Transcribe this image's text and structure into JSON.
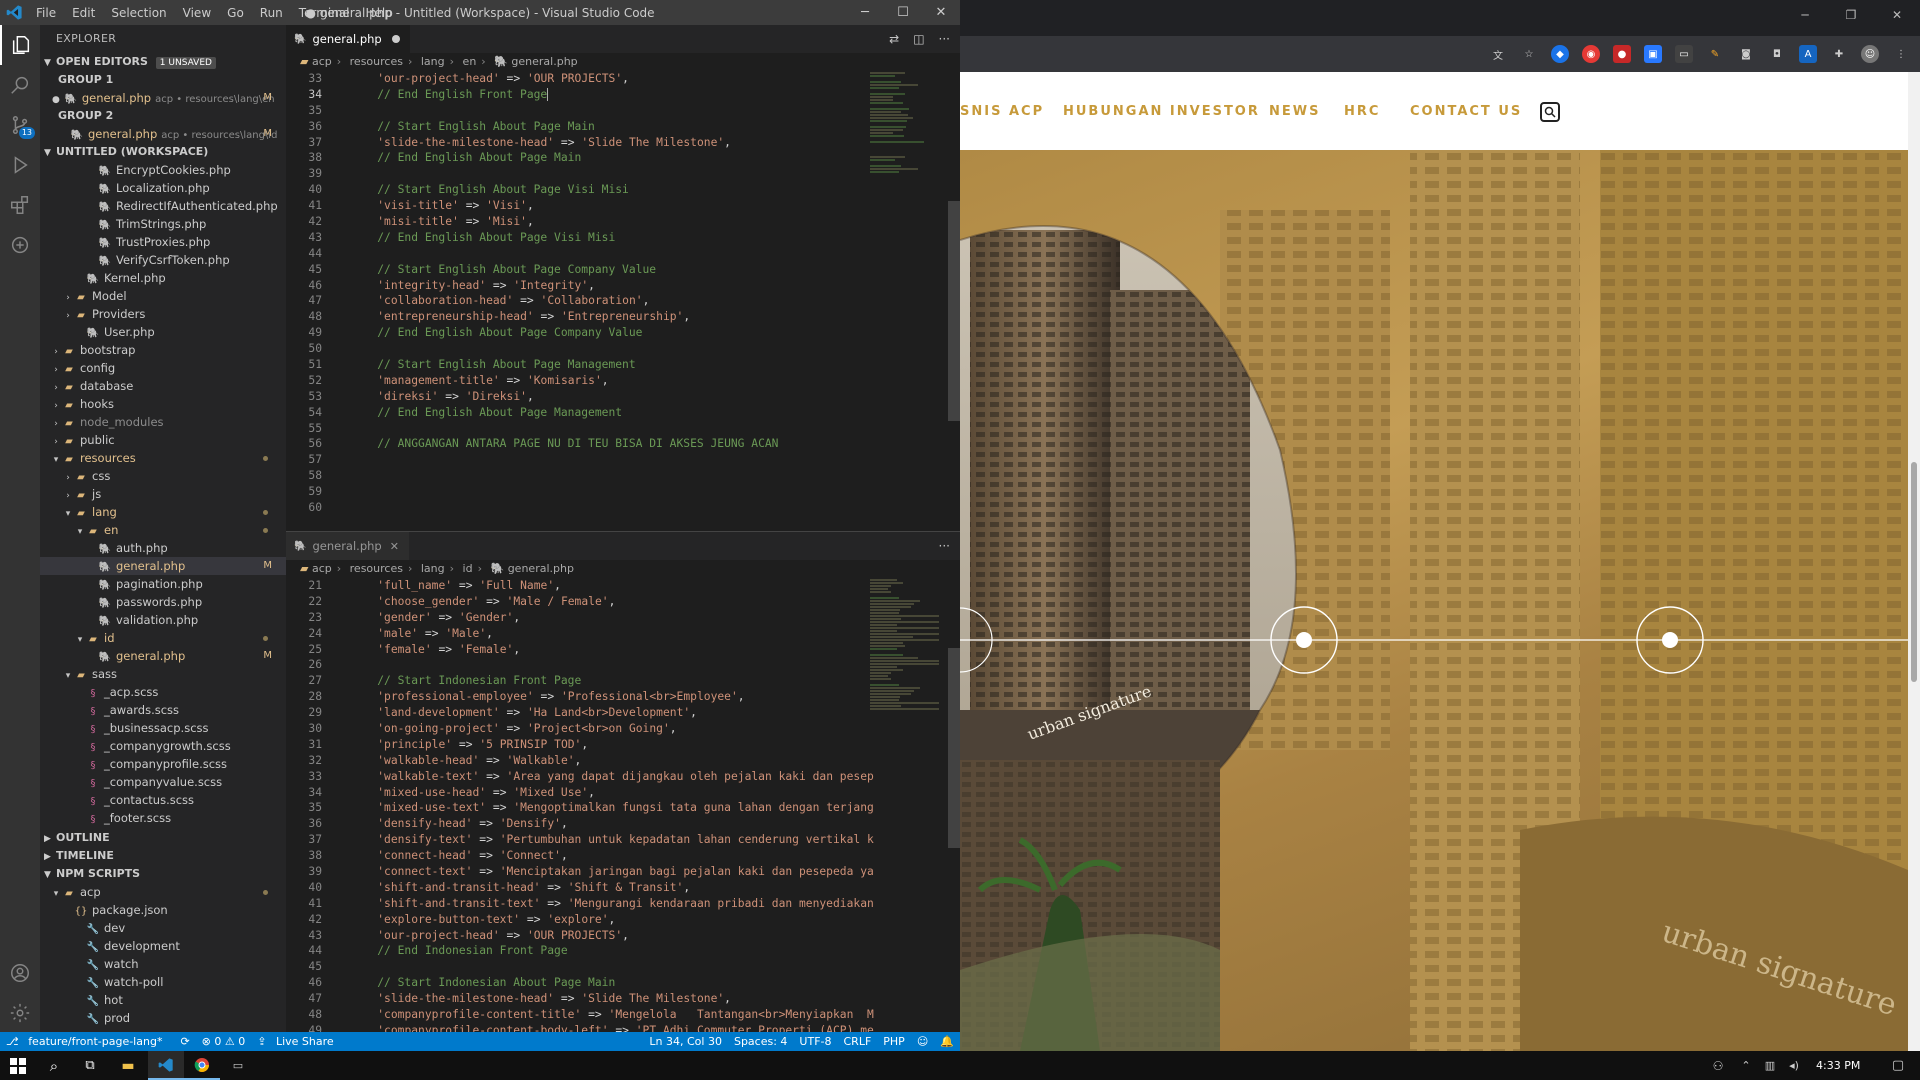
{
  "window": {
    "title": "● general.php - Untitled (Workspace) - Visual Studio Code",
    "menu": [
      "File",
      "Edit",
      "Selection",
      "View",
      "Go",
      "Run",
      "Terminal",
      "Help"
    ]
  },
  "activity_bar": {
    "scm_badge": "13"
  },
  "sidebar": {
    "title": "EXPLORER",
    "open_editors": {
      "label": "OPEN EDITORS",
      "badge": "1 UNSAVED"
    },
    "group1": {
      "label": "GROUP 1",
      "file": "general.php",
      "desc": "acp • resources\\lang\\en",
      "mark": "M"
    },
    "group2": {
      "label": "GROUP 2",
      "file": "general.php",
      "desc": "acp • resources\\lang\\id",
      "mark": "M"
    },
    "workspace": {
      "label": "UNTITLED (WORKSPACE)"
    },
    "tree": [
      {
        "label": "EncryptCookies.php",
        "indent": 3,
        "type": "php"
      },
      {
        "label": "Localization.php",
        "indent": 3,
        "type": "php"
      },
      {
        "label": "RedirectIfAuthenticated.php",
        "indent": 3,
        "type": "php"
      },
      {
        "label": "TrimStrings.php",
        "indent": 3,
        "type": "php"
      },
      {
        "label": "TrustProxies.php",
        "indent": 3,
        "type": "php"
      },
      {
        "label": "VerifyCsrfToken.php",
        "indent": 3,
        "type": "php"
      },
      {
        "label": "Kernel.php",
        "indent": 2,
        "type": "php"
      },
      {
        "label": "Model",
        "indent": 1,
        "type": "folder-closed"
      },
      {
        "label": "Providers",
        "indent": 1,
        "type": "folder-closed"
      },
      {
        "label": "User.php",
        "indent": 2,
        "type": "php"
      },
      {
        "label": "bootstrap",
        "indent": 0,
        "type": "folder-closed"
      },
      {
        "label": "config",
        "indent": 0,
        "type": "folder-closed"
      },
      {
        "label": "database",
        "indent": 0,
        "type": "folder-closed"
      },
      {
        "label": "hooks",
        "indent": 0,
        "type": "folder-closed"
      },
      {
        "label": "node_modules",
        "indent": 0,
        "type": "folder-closed",
        "dim": true
      },
      {
        "label": "public",
        "indent": 0,
        "type": "folder-closed"
      },
      {
        "label": "resources",
        "indent": 0,
        "type": "folder-open",
        "gold": true,
        "dot": true
      },
      {
        "label": "css",
        "indent": 1,
        "type": "folder-closed"
      },
      {
        "label": "js",
        "indent": 1,
        "type": "folder-closed"
      },
      {
        "label": "lang",
        "indent": 1,
        "type": "folder-open",
        "gold": true,
        "dot": true
      },
      {
        "label": "en",
        "indent": 2,
        "type": "folder-open",
        "gold": true,
        "dot": true
      },
      {
        "label": "auth.php",
        "indent": 3,
        "type": "php"
      },
      {
        "label": "general.php",
        "indent": 3,
        "type": "php",
        "gold": true,
        "mark": "M",
        "selected": true
      },
      {
        "label": "pagination.php",
        "indent": 3,
        "type": "php"
      },
      {
        "label": "passwords.php",
        "indent": 3,
        "type": "php"
      },
      {
        "label": "validation.php",
        "indent": 3,
        "type": "php"
      },
      {
        "label": "id",
        "indent": 2,
        "type": "folder-open",
        "gold": true,
        "dot": true
      },
      {
        "label": "general.php",
        "indent": 3,
        "type": "php",
        "gold": true,
        "mark": "M"
      },
      {
        "label": "sass",
        "indent": 1,
        "type": "folder-open"
      },
      {
        "label": "_acp.scss",
        "indent": 2,
        "type": "sass"
      },
      {
        "label": "_awards.scss",
        "indent": 2,
        "type": "sass"
      },
      {
        "label": "_businessacp.scss",
        "indent": 2,
        "type": "sass"
      },
      {
        "label": "_companygrowth.scss",
        "indent": 2,
        "type": "sass"
      },
      {
        "label": "_companyprofile.scss",
        "indent": 2,
        "type": "sass"
      },
      {
        "label": "_companyvalue.scss",
        "indent": 2,
        "type": "sass"
      },
      {
        "label": "_contactus.scss",
        "indent": 2,
        "type": "sass"
      },
      {
        "label": "_footer.scss",
        "indent": 2,
        "type": "sass"
      }
    ],
    "outline": "OUTLINE",
    "timeline": "TIMELINE",
    "npm": {
      "label": "NPM SCRIPTS",
      "items": [
        {
          "label": "acp",
          "indent": 0,
          "type": "folder-open",
          "dot": true
        },
        {
          "label": "package.json",
          "indent": 1,
          "type": "json"
        },
        {
          "label": "dev",
          "indent": 2,
          "type": "wrench"
        },
        {
          "label": "development",
          "indent": 2,
          "type": "wrench"
        },
        {
          "label": "watch",
          "indent": 2,
          "type": "wrench"
        },
        {
          "label": "watch-poll",
          "indent": 2,
          "type": "wrench"
        },
        {
          "label": "hot",
          "indent": 2,
          "type": "wrench"
        },
        {
          "label": "prod",
          "indent": 2,
          "type": "wrench"
        }
      ]
    }
  },
  "editor_top": {
    "tab": "general.php",
    "breadcrumb": [
      "acp",
      "resources",
      "lang",
      "en",
      "general.php"
    ],
    "cursor_line": 34,
    "lines": [
      {
        "n": 33,
        "t": "    'our-project-head' => 'OUR PROJECTS',"
      },
      {
        "n": 34,
        "t": "    // End English Front Page"
      },
      {
        "n": 35,
        "t": ""
      },
      {
        "n": 36,
        "t": "    // Start English About Page Main"
      },
      {
        "n": 37,
        "t": "    'slide-the-milestone-head' => 'Slide The Milestone',"
      },
      {
        "n": 38,
        "t": "    // End English About Page Main"
      },
      {
        "n": 39,
        "t": ""
      },
      {
        "n": 40,
        "t": "    // Start English About Page Visi Misi"
      },
      {
        "n": 41,
        "t": "    'visi-title' => 'Visi',"
      },
      {
        "n": 42,
        "t": "    'misi-title' => 'Misi',"
      },
      {
        "n": 43,
        "t": "    // End English About Page Visi Misi"
      },
      {
        "n": 44,
        "t": ""
      },
      {
        "n": 45,
        "t": "    // Start English About Page Company Value"
      },
      {
        "n": 46,
        "t": "    'integrity-head' => 'Integrity',"
      },
      {
        "n": 47,
        "t": "    'collaboration-head' => 'Collaboration',"
      },
      {
        "n": 48,
        "t": "    'entrepreneurship-head' => 'Entrepreneurship',"
      },
      {
        "n": 49,
        "t": "    // End English About Page Company Value"
      },
      {
        "n": 50,
        "t": ""
      },
      {
        "n": 51,
        "t": "    // Start English About Page Management"
      },
      {
        "n": 52,
        "t": "    'management-title' => 'Komisaris',"
      },
      {
        "n": 53,
        "t": "    'direksi' => 'Direksi',"
      },
      {
        "n": 54,
        "t": "    // End English About Page Management"
      },
      {
        "n": 55,
        "t": ""
      },
      {
        "n": 56,
        "t": "    // ANGGANGAN ANTARA PAGE NU DI TEU BISA DI AKSES JEUNG ACAN"
      },
      {
        "n": 57,
        "t": ""
      },
      {
        "n": 58,
        "t": ""
      },
      {
        "n": 59,
        "t": ""
      },
      {
        "n": 60,
        "t": ""
      }
    ]
  },
  "editor_bottom": {
    "tab": "general.php",
    "breadcrumb": [
      "acp",
      "resources",
      "lang",
      "id",
      "general.php"
    ],
    "lines": [
      {
        "n": 21,
        "t": "    'full_name' => 'Full Name',"
      },
      {
        "n": 22,
        "t": "    'choose_gender' => 'Male / Female',"
      },
      {
        "n": 23,
        "t": "    'gender' => 'Gender',"
      },
      {
        "n": 24,
        "t": "    'male' => 'Male',"
      },
      {
        "n": 25,
        "t": "    'female' => 'Female',"
      },
      {
        "n": 26,
        "t": ""
      },
      {
        "n": 27,
        "t": "    // Start Indonesian Front Page"
      },
      {
        "n": 28,
        "t": "    'professional-employee' => 'Professional<br>Employee',"
      },
      {
        "n": 29,
        "t": "    'land-development' => 'Ha Land<br>Development',"
      },
      {
        "n": 30,
        "t": "    'on-going-project' => 'Project<br>on Going',"
      },
      {
        "n": 31,
        "t": "    'principle' => '5 PRINSIP TOD',"
      },
      {
        "n": 32,
        "t": "    'walkable-head' => 'Walkable',"
      },
      {
        "n": 33,
        "t": "    'walkable-text' => 'Area yang dapat dijangkau oleh pejalan kaki dan pesepeda"
      },
      {
        "n": 34,
        "t": "    'mixed-use-head' => 'Mixed Use',"
      },
      {
        "n": 35,
        "t": "    'mixed-use-text' => 'Mengoptimalkan fungsi tata guna lahan dengan terjangkaun"
      },
      {
        "n": 36,
        "t": "    'densify-head' => 'Densify',"
      },
      {
        "n": 37,
        "t": "    'densify-text' => 'Pertumbuhan untuk kepadatan lahan cenderung vertikal ke at"
      },
      {
        "n": 38,
        "t": "    'connect-head' => 'Connect',"
      },
      {
        "n": 39,
        "t": "    'connect-text' => 'Menciptakan jaringan bagi pejalan kaki dan pesepeda yang t"
      },
      {
        "n": 40,
        "t": "    'shift-and-transit-head' => 'Shift & Transit',"
      },
      {
        "n": 41,
        "t": "    'shift-and-transit-text' => 'Mengurangi kendaraan pribadi dan menyediakan tra"
      },
      {
        "n": 42,
        "t": "    'explore-button-text' => 'explore',"
      },
      {
        "n": 43,
        "t": "    'our-project-head' => 'OUR PROJECTS',"
      },
      {
        "n": 44,
        "t": "    // End Indonesian Front Page"
      },
      {
        "n": 45,
        "t": ""
      },
      {
        "n": 46,
        "t": "    // Start Indonesian About Page Main"
      },
      {
        "n": 47,
        "t": "    'slide-the-milestone-head' => 'Slide The Milestone',"
      },
      {
        "n": 48,
        "t": "    'companyprofile-content-title' => 'Mengelola   Tantangan<br>Menyiapkan  Masa"
      },
      {
        "n": 49,
        "t": "    'companyprofile-content-body-left' => 'PT Adhi Commuter Properti (ACP) merupa"
      }
    ]
  },
  "status": {
    "branch": "feature/front-page-lang*",
    "problems": "⊗ 0 ⚠ 0",
    "liveshare": "Live Share",
    "position": "Ln 34, Col 30",
    "spaces": "Spaces: 4",
    "encoding": "UTF-8",
    "eol": "CRLF",
    "language": "PHP"
  },
  "browser": {
    "nav_items": [
      "SNIS ACP",
      "HUBUNGAN INVESTOR",
      "NEWS",
      "HRC",
      "CONTACT US"
    ],
    "building_sign_1": "urban signature",
    "building_sign_2": "urban signature",
    "accent": "#c79a3a"
  },
  "taskbar": {
    "time": "4:33 PM"
  }
}
